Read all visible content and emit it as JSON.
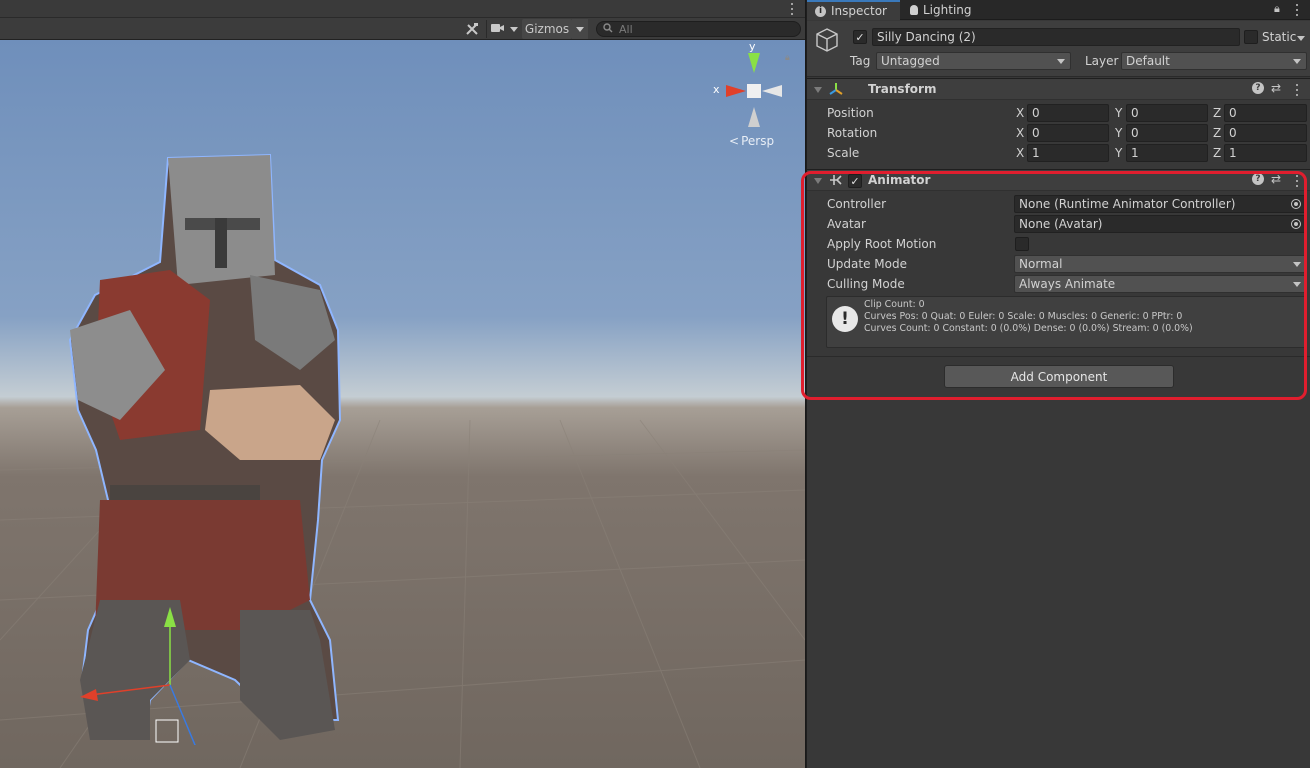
{
  "scene": {
    "toolbar": {
      "gizmos_label": "Gizmos",
      "search_placeholder": "All"
    },
    "orientation_gizmo": {
      "x_label": "x",
      "y_label": "y",
      "projection_label": "Persp"
    }
  },
  "inspector": {
    "tabs": [
      {
        "label": "Inspector",
        "icon": "info-icon",
        "active": true
      },
      {
        "label": "Lighting",
        "icon": "lightbulb-icon",
        "active": false
      }
    ],
    "object": {
      "name": "Silly Dancing (2)",
      "active": true,
      "static_label": "Static",
      "tag_label": "Tag",
      "tag_value": "Untagged",
      "layer_label": "Layer",
      "layer_value": "Default"
    },
    "transform": {
      "title": "Transform",
      "rows": [
        {
          "label": "Position",
          "x": "0",
          "y": "0",
          "z": "0"
        },
        {
          "label": "Rotation",
          "x": "0",
          "y": "0",
          "z": "0"
        },
        {
          "label": "Scale",
          "x": "1",
          "y": "1",
          "z": "1"
        }
      ],
      "axis_x": "X",
      "axis_y": "Y",
      "axis_z": "Z"
    },
    "animator": {
      "title": "Animator",
      "enabled": true,
      "controller_label": "Controller",
      "controller_value": "None (Runtime Animator Controller)",
      "avatar_label": "Avatar",
      "avatar_value": "None (Avatar)",
      "apply_root_motion_label": "Apply Root Motion",
      "apply_root_motion": false,
      "update_mode_label": "Update Mode",
      "update_mode_value": "Normal",
      "culling_mode_label": "Culling Mode",
      "culling_mode_value": "Always Animate",
      "info_lines": [
        "Clip Count: 0",
        "Curves Pos: 0 Quat: 0 Euler: 0 Scale: 0 Muscles: 0 Generic: 0 PPtr: 0",
        "Curves Count: 0 Constant: 0 (0.0%) Dense: 0 (0.0%) Stream: 0 (0.0%)"
      ]
    },
    "add_component_label": "Add Component",
    "colors": {
      "highlight": "#e01e2e",
      "tab_accent": "#3a79bb"
    }
  }
}
